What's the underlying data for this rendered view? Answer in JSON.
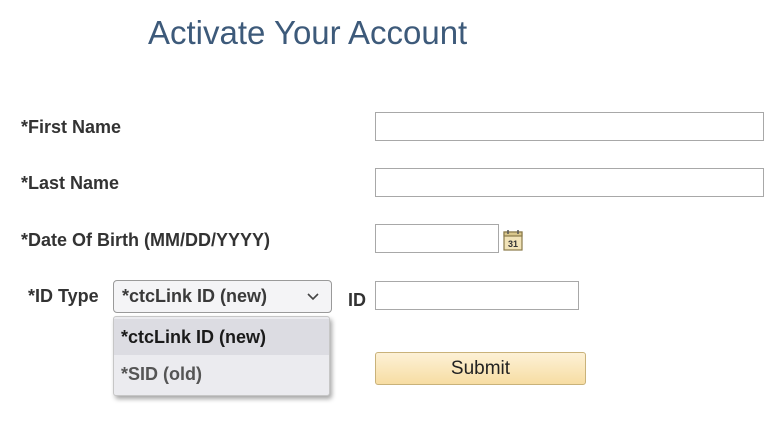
{
  "header": {
    "title": "Activate Your Account"
  },
  "form": {
    "first_name": {
      "label": "*First Name",
      "value": ""
    },
    "last_name": {
      "label": "*Last Name",
      "value": ""
    },
    "dob": {
      "label": "*Date Of Birth (MM/DD/YYYY)",
      "value": "",
      "icon": "calendar-icon",
      "icon_text": "31"
    },
    "id_type": {
      "label": "*ID Type",
      "selected": "*ctcLink ID (new)",
      "options": [
        "*ctcLink ID (new)",
        "*SID (old)"
      ]
    },
    "id": {
      "label": "ID",
      "value": ""
    },
    "submit_label": "Submit"
  },
  "colors": {
    "title": "#3d5a7a",
    "submit_top": "#fdf1d6",
    "submit_bottom": "#f7dda3"
  }
}
